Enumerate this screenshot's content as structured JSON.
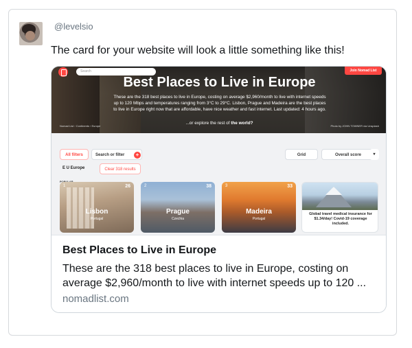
{
  "tweet": {
    "handle": "@levelsio",
    "text": "The card for your website will look a little something like this!"
  },
  "card": {
    "title": "Best Places to Live in Europe",
    "description": "These are the 318 best places to live in Europe, costing on average $2,960/month to live with internet speeds up to 120 ...",
    "domain": "nomadlist.com",
    "preview": {
      "search_placeholder": "Search",
      "join_label": "Join Nomad List",
      "hero_title": "Best Places to Live in Europe",
      "hero_description": "These are the 318 best places to live in Europe, costing on average $2,960/month to live with internet speeds up to 120 Mbps and temperatures ranging from 3°C to 29°C. Lisbon, Prague and Madeira are the best places to live in Europe right now that are affordable, have nice weather and fast internet. Last updated: 4 hours ago.",
      "explore_text": "...or explore the rest of",
      "explore_link": "the world?",
      "breadcrumb": "Nomad List › Continents › Europe",
      "photo_credit": "Photo by JOHN TOWNER via Unsplash",
      "filters": {
        "all_filters": "All filters",
        "search_filter": "Search or filter",
        "plus": "+",
        "grid": "Grid",
        "overall_score": "Overall score",
        "caret": "▾",
        "region": "E U Europe",
        "clear": "Clear 318 results"
      },
      "popular_label": "POPULAR",
      "cities": [
        {
          "rank": "1",
          "temp": "26",
          "name": "Lisbon",
          "country": "Portugal"
        },
        {
          "rank": "2",
          "temp": "38",
          "name": "Prague",
          "country": "Czechia"
        },
        {
          "rank": "3",
          "temp": "33",
          "name": "Madeira",
          "country": "Portugal"
        }
      ],
      "ad": {
        "headline": "Global travel medical insurance for $1.34/day! Covid-19 coverage included."
      }
    }
  }
}
